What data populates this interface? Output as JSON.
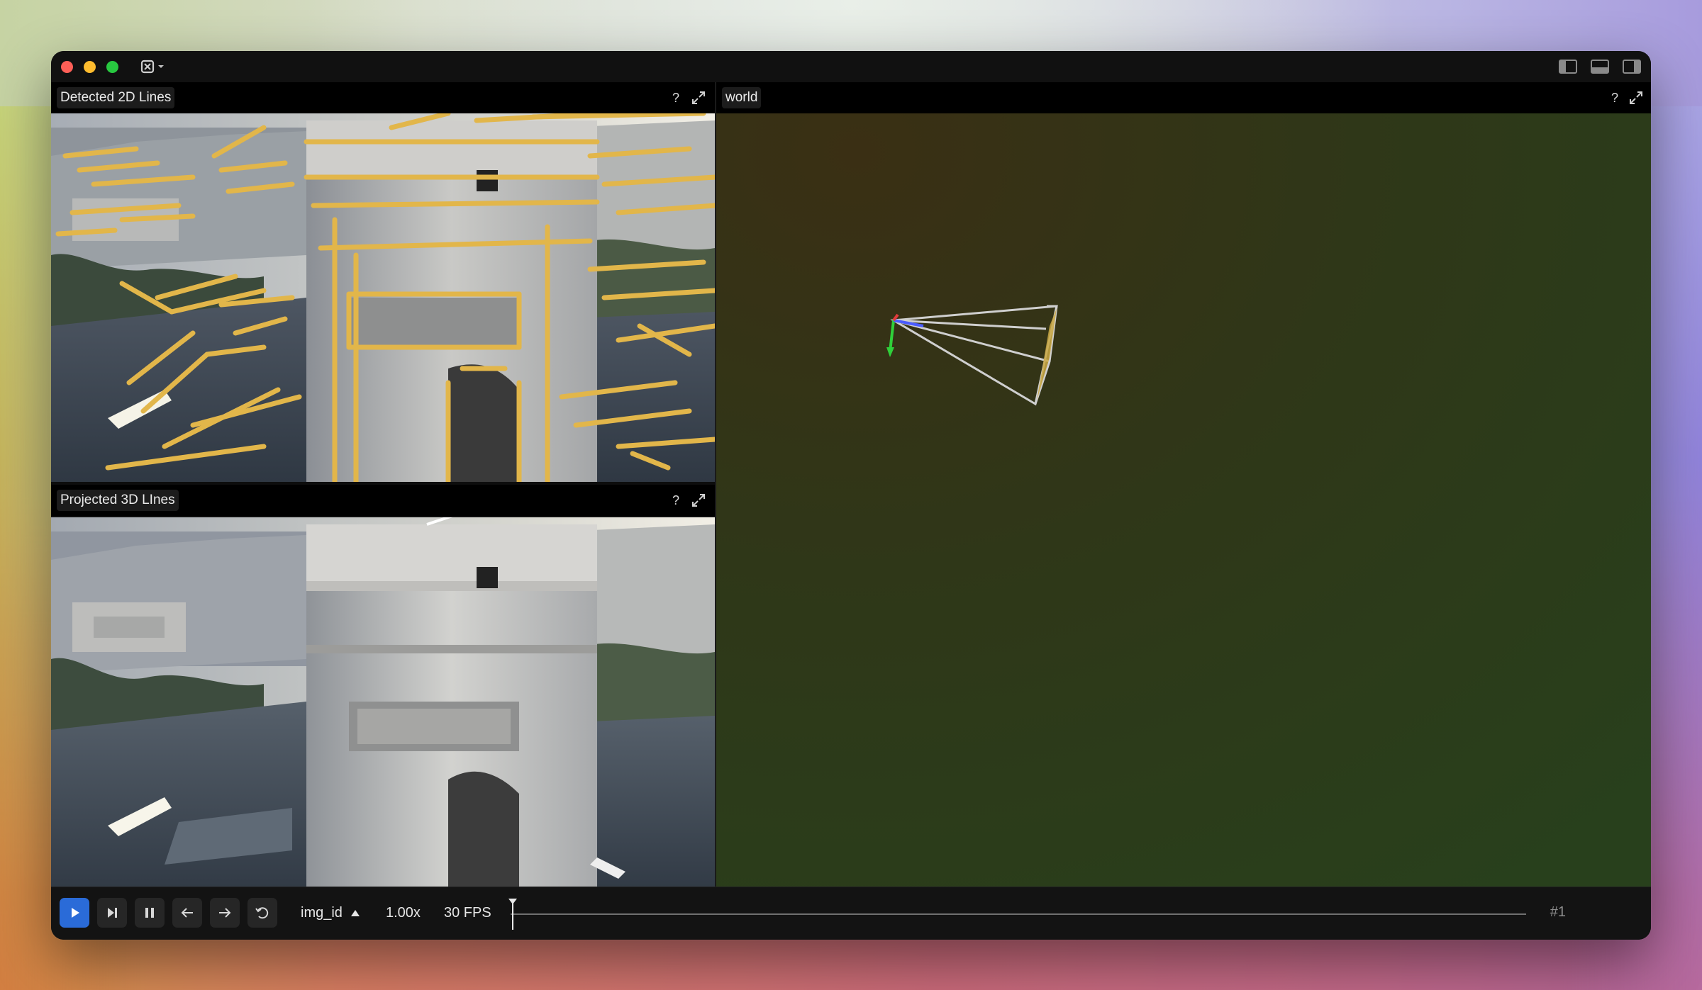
{
  "panels": {
    "detected": {
      "title": "Detected 2D Lines",
      "help": "?"
    },
    "projected": {
      "title": "Projected 3D LInes",
      "help": "?"
    },
    "world": {
      "title": "world",
      "help": "?"
    }
  },
  "toolbar": {
    "timeline_name": "img_id",
    "playback_speed": "1.00x",
    "fps": "30 FPS",
    "frame_label": "#1"
  },
  "icons": {
    "app_menu": "rerun-logo-icon",
    "layout": [
      "left-panel-toggle-icon",
      "bottom-panel-toggle-icon",
      "right-panel-toggle-icon"
    ],
    "panel": [
      "help-icon",
      "maximize-icon"
    ],
    "toolbar": [
      "play-icon",
      "step-forward-icon",
      "pause-icon",
      "arrow-left-icon",
      "arrow-right-icon",
      "loop-icon",
      "sort-ascending-icon"
    ]
  },
  "colors": {
    "accent_play": "#2a6bd8",
    "detected_line_overlay": "#e2b64a",
    "world_background": "#2f3a16",
    "camera_frustum": "#cfcfcf",
    "axis_x": "#e03b3b",
    "axis_y": "#2fd03a",
    "axis_z": "#4a5cff"
  }
}
